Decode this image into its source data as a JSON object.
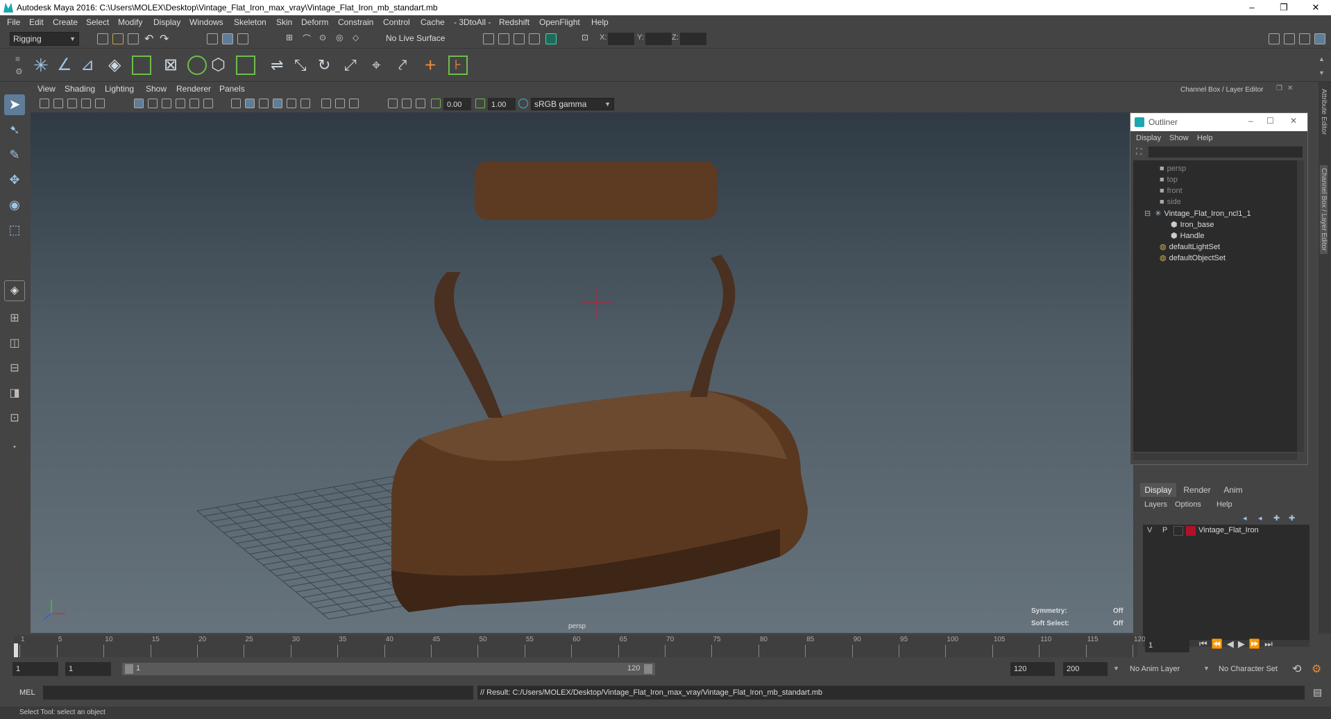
{
  "window": {
    "title": "Autodesk Maya 2016: C:\\Users\\MOLEX\\Desktop\\Vintage_Flat_Iron_max_vray\\Vintage_Flat_Iron_mb_standart.mb",
    "minimize": "–",
    "maximize": "❐",
    "close": "✕"
  },
  "menus": [
    "File",
    "Edit",
    "Create",
    "Select",
    "Modify",
    "Display",
    "Windows",
    "Skeleton",
    "Skin",
    "Deform",
    "Constrain",
    "Control",
    "Cache",
    "- 3DtoAll -",
    "Redshift",
    "OpenFlight",
    "Help"
  ],
  "toolbar": {
    "mode": "Rigging",
    "live_surface": "No Live Surface",
    "x_label": "X:",
    "y_label": "Y:",
    "z_label": "Z:"
  },
  "viewport_menu": [
    "View",
    "Shading",
    "Lighting",
    "Show",
    "Renderer",
    "Panels"
  ],
  "viewport_toolbar": {
    "exposure": "0.00",
    "gamma": "1.00",
    "color_space": "sRGB gamma"
  },
  "viewport": {
    "camera": "persp",
    "symmetry_label": "Symmetry:",
    "symmetry_value": "Off",
    "soft_select_label": "Soft Select:",
    "soft_select_value": "Off"
  },
  "channel_box": {
    "title": "Channel Box / Layer Editor"
  },
  "outliner": {
    "title": "Outliner",
    "menus": [
      "Display",
      "Show",
      "Help"
    ],
    "items": [
      {
        "label": "persp",
        "dim": true
      },
      {
        "label": "top",
        "dim": true
      },
      {
        "label": "front",
        "dim": true
      },
      {
        "label": "side",
        "dim": true
      },
      {
        "label": "Vintage_Flat_Iron_ncl1_1",
        "dim": false
      },
      {
        "label": "Iron_base",
        "dim": false
      },
      {
        "label": "Handle",
        "dim": false
      },
      {
        "label": "defaultLightSet",
        "dim": false
      },
      {
        "label": "defaultObjectSet",
        "dim": false
      }
    ]
  },
  "layer_editor": {
    "tabs": [
      "Display",
      "Render",
      "Anim"
    ],
    "menus": [
      "Layers",
      "Options",
      "Help"
    ],
    "layer": {
      "v": "V",
      "p": "P",
      "name": "Vintage_Flat_Iron",
      "color": "#b0102a"
    }
  },
  "side_tabs": [
    "Attribute Editor",
    "Channel Box / Layer Editor"
  ],
  "timeline": {
    "ticks": [
      "1",
      "5",
      "10",
      "15",
      "20",
      "25",
      "30",
      "35",
      "40",
      "45",
      "50",
      "55",
      "60",
      "65",
      "70",
      "75",
      "80",
      "85",
      "90",
      "95",
      "100",
      "105",
      "110",
      "115",
      "120"
    ],
    "current_frame": "1"
  },
  "range": {
    "start": "1",
    "playback_start": "1",
    "slider_start": "1",
    "slider_end": "120",
    "playback_end": "120",
    "end": "200",
    "anim_layer": "No Anim Layer",
    "character_set": "No Character Set"
  },
  "command": {
    "lang": "MEL",
    "result": "// Result: C:/Users/MOLEX/Desktop/Vintage_Flat_Iron_max_vray/Vintage_Flat_Iron_mb_standart.mb"
  },
  "help_line": "Select Tool: select an object"
}
